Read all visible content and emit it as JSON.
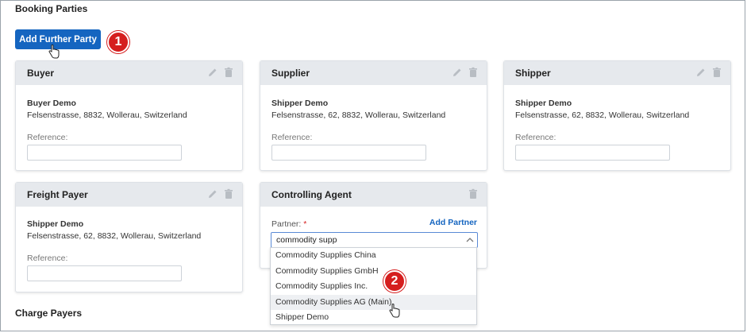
{
  "booking_parties": {
    "title": "Booking Parties",
    "add_button": "Add Further Party",
    "step_badges": [
      "1",
      "2"
    ]
  },
  "cards": {
    "buyer": {
      "title": "Buyer",
      "name": "Buyer Demo",
      "address": "Felsenstrasse, 8832, Wollerau, Switzerland",
      "reference_label": "Reference:",
      "reference_value": ""
    },
    "supplier": {
      "title": "Supplier",
      "name": "Shipper Demo",
      "address": "Felsenstrasse, 62, 8832, Wollerau, Switzerland",
      "reference_label": "Reference:",
      "reference_value": ""
    },
    "shipper": {
      "title": "Shipper",
      "name": "Shipper Demo",
      "address": "Felsenstrasse, 62, 8832, Wollerau, Switzerland",
      "reference_label": "Reference:",
      "reference_value": ""
    },
    "freight_payer": {
      "title": "Freight Payer",
      "name": "Shipper Demo",
      "address": "Felsenstrasse, 62, 8832, Wollerau, Switzerland",
      "reference_label": "Reference:",
      "reference_value": ""
    },
    "controlling_agent": {
      "title": "Controlling Agent",
      "partner_label": "Partner:",
      "required_mark": "*",
      "add_partner": "Add Partner",
      "search_value": "commodity supp",
      "options": [
        "Commodity Supplies China",
        "Commodity Supplies GmbH",
        "Commodity Supplies Inc.",
        "Commodity Supplies AG (Main)",
        "Shipper Demo"
      ],
      "highlighted_option": "Commodity Supplies AG (Main)"
    }
  },
  "charge_payers": {
    "title": "Charge Payers"
  },
  "colors": {
    "primary": "#1565c0",
    "badge": "#d51e1e",
    "card_header": "#e6e9ed",
    "frame_border": "#9aa3ab"
  },
  "icons": [
    "pencil-icon",
    "trash-icon",
    "chevron-up-icon",
    "hand-pointer-icon"
  ]
}
